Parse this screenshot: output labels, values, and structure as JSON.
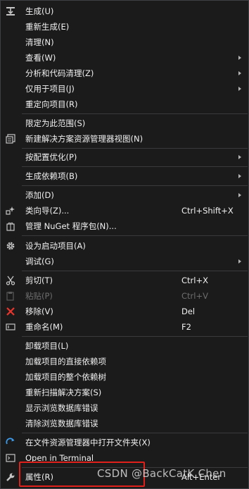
{
  "menu": {
    "items": [
      {
        "label": "生成(U)",
        "shortcut": "",
        "submenu": false,
        "icon": "build-icon"
      },
      {
        "label": "重新生成(E)",
        "shortcut": "",
        "submenu": false,
        "icon": ""
      },
      {
        "label": "清理(N)",
        "shortcut": "",
        "submenu": false,
        "icon": ""
      },
      {
        "label": "查看(W)",
        "shortcut": "",
        "submenu": true,
        "icon": ""
      },
      {
        "label": "分析和代码清理(Z)",
        "shortcut": "",
        "submenu": true,
        "icon": ""
      },
      {
        "label": "仅用于项目(J)",
        "shortcut": "",
        "submenu": true,
        "icon": ""
      },
      {
        "label": "重定向项目(R)",
        "shortcut": "",
        "submenu": false,
        "icon": ""
      },
      {
        "label": "限定为此范围(S)",
        "shortcut": "",
        "submenu": false,
        "icon": ""
      },
      {
        "label": "新建解决方案资源管理器视图(N)",
        "shortcut": "",
        "submenu": false,
        "icon": "new-view-icon"
      },
      {
        "label": "按配置优化(P)",
        "shortcut": "",
        "submenu": true,
        "icon": ""
      },
      {
        "label": "生成依赖项(B)",
        "shortcut": "",
        "submenu": true,
        "icon": ""
      },
      {
        "label": "添加(D)",
        "shortcut": "",
        "submenu": true,
        "icon": ""
      },
      {
        "label": "类向导(Z)...",
        "shortcut": "Ctrl+Shift+X",
        "submenu": false,
        "icon": "class-wizard-icon"
      },
      {
        "label": "管理 NuGet 程序包(N)...",
        "shortcut": "",
        "submenu": false,
        "icon": "nuget-icon"
      },
      {
        "label": "设为启动项目(A)",
        "shortcut": "",
        "submenu": false,
        "icon": "gear-icon"
      },
      {
        "label": "调试(G)",
        "shortcut": "",
        "submenu": true,
        "icon": ""
      },
      {
        "label": "剪切(T)",
        "shortcut": "Ctrl+X",
        "submenu": false,
        "icon": "scissors-icon"
      },
      {
        "label": "粘贴(P)",
        "shortcut": "Ctrl+V",
        "submenu": false,
        "icon": "paste-icon",
        "disabled": true
      },
      {
        "label": "移除(V)",
        "shortcut": "Del",
        "submenu": false,
        "icon": "remove-icon"
      },
      {
        "label": "重命名(M)",
        "shortcut": "F2",
        "submenu": false,
        "icon": "rename-icon"
      },
      {
        "label": "卸载项目(L)",
        "shortcut": "",
        "submenu": false,
        "icon": ""
      },
      {
        "label": "加载项目的直接依赖项",
        "shortcut": "",
        "submenu": false,
        "icon": ""
      },
      {
        "label": "加载项目的整个依赖树",
        "shortcut": "",
        "submenu": false,
        "icon": ""
      },
      {
        "label": "重新扫描解决方案(S)",
        "shortcut": "",
        "submenu": false,
        "icon": ""
      },
      {
        "label": "显示浏览数据库错误",
        "shortcut": "",
        "submenu": false,
        "icon": ""
      },
      {
        "label": "清除浏览数据库错误",
        "shortcut": "",
        "submenu": false,
        "icon": ""
      },
      {
        "label": "在文件资源管理器中打开文件夹(X)",
        "shortcut": "",
        "submenu": false,
        "icon": "refresh-folder-icon"
      },
      {
        "label": "Open in Terminal",
        "shortcut": "",
        "submenu": false,
        "icon": "terminal-icon"
      },
      {
        "label": "属性(R)",
        "shortcut": "Alt+Enter",
        "submenu": false,
        "icon": "wrench-icon"
      }
    ]
  },
  "watermark": "CSDN @BackCatK Chen",
  "colors": {
    "background": "#1b1b1c",
    "text": "#f1f1f1",
    "highlight": "#e0201b",
    "separator": "#3a3a3c",
    "remove_icon": "#e8362d",
    "refresh_icon": "#3d9be9"
  }
}
